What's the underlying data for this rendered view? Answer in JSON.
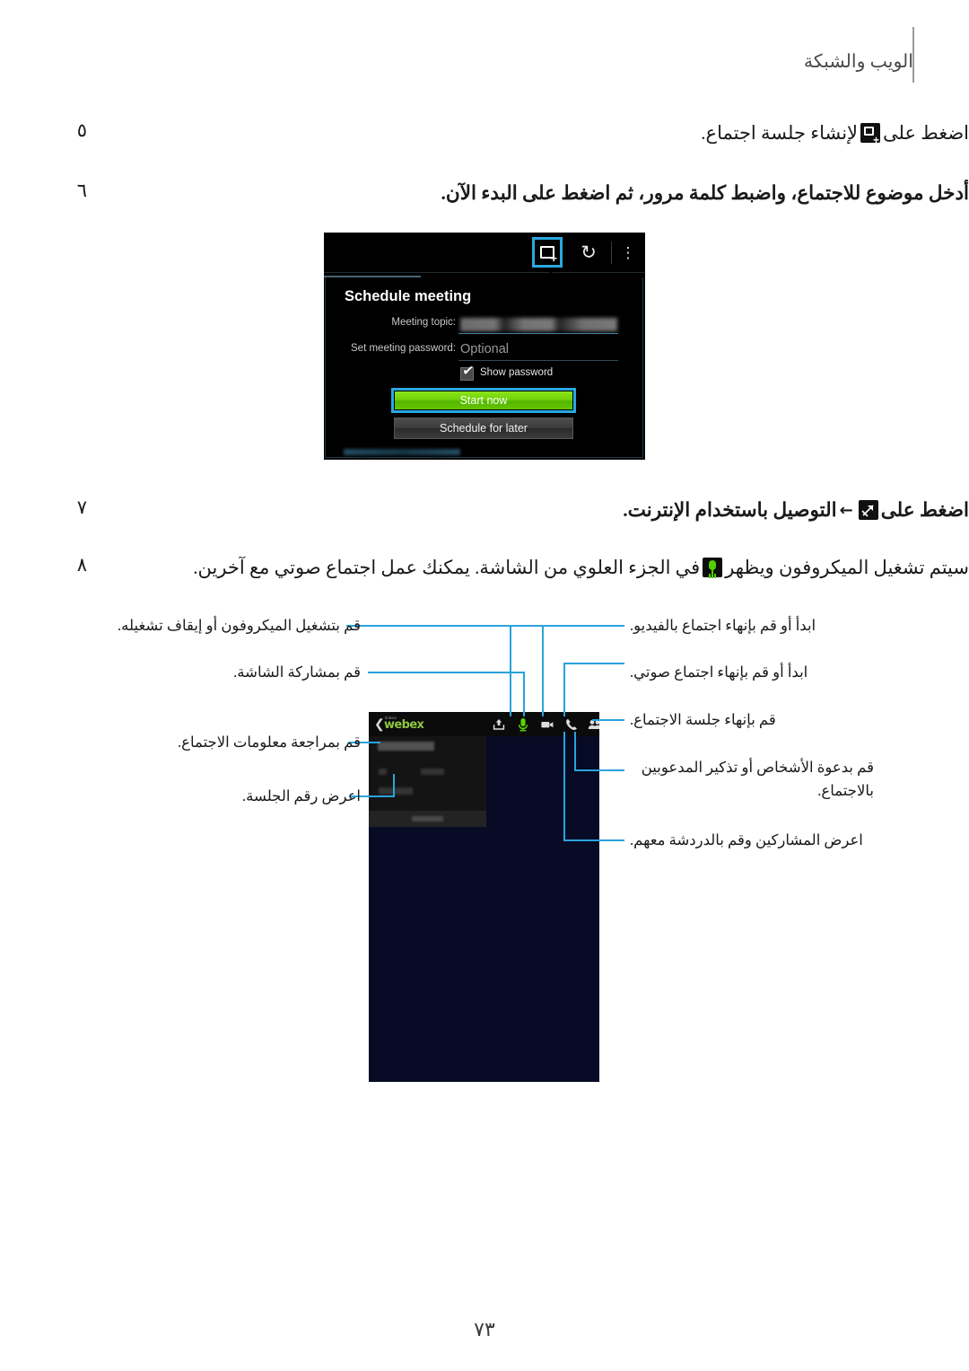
{
  "header": {
    "title": "الويب والشبكة"
  },
  "steps": [
    {
      "number": "٥",
      "text_before": "اضغط على",
      "icon": "new-meeting-icon",
      "text_after": "لإنشاء جلسة اجتماع."
    },
    {
      "number": "٦",
      "text": "أدخل موضوع للاجتماع، واضبط كلمة مرور، ثم اضغط على البدء الآن.",
      "bold_part": "البدء الآن"
    },
    {
      "number": "٧",
      "text_before": "اضغط على",
      "icon": "connect-icon",
      "arrow": "←",
      "text_after": "التوصيل باستخدام الإنترنت."
    },
    {
      "number": "٨",
      "text_before": "سيتم تشغيل الميكروفون ويظهر",
      "icon": "microphone-icon",
      "text_after": "في الجزء العلوي من الشاشة. يمكنك عمل اجتماع صوتي مع آخرين."
    }
  ],
  "schedule_screenshot": {
    "actionbar": {
      "new_meeting_icon": "new-meeting-icon",
      "refresh_icon": "refresh-icon",
      "more_icon": "more-options-icon"
    },
    "dialog_title": "Schedule meeting",
    "fields": [
      {
        "label": "Meeting topic:",
        "value": ""
      },
      {
        "label": "Set meeting password:",
        "placeholder": "Optional"
      }
    ],
    "checkbox": {
      "label": "Show password",
      "checked": true
    },
    "buttons": {
      "primary": "Start now",
      "secondary": "Schedule for later"
    },
    "highlight_color": "#2aa8e0",
    "primary_color": "#6fcf08"
  },
  "webex_screenshot": {
    "brand_small": "Cisco",
    "brand": "webex",
    "back_icon": "back-chevron-icon",
    "toolbar_icons": [
      "share-screen-icon",
      "microphone-icon",
      "video-camera-icon",
      "phone-icon",
      "participants-icon",
      "invite-person-icon",
      "exit-meeting-icon"
    ],
    "mic_color": "#5bd600"
  },
  "callouts": {
    "left": [
      "قم بتشغيل الميكروفون أو إيقاف تشغيله.",
      "قم بمشاركة الشاشة.",
      "قم بمراجعة معلومات الاجتماع.",
      "اعرض رقم الجلسة."
    ],
    "right": [
      "ابدأ أو قم بإنهاء اجتماع بالفيديو.",
      "ابدأ أو قم بإنهاء اجتماع صوتي.",
      "قم بإنهاء جلسة الاجتماع.",
      "قم بدعوة الأشخاص أو تذكير المدعوبين بالاجتماع.",
      "اعرض المشاركين وقم بالدردشة معهم."
    ]
  },
  "footer": {
    "page_number": "٧٣"
  },
  "colors": {
    "leader_line": "#29a3dc",
    "text": "#1a1a1a",
    "header_text": "#4b4b4b"
  }
}
